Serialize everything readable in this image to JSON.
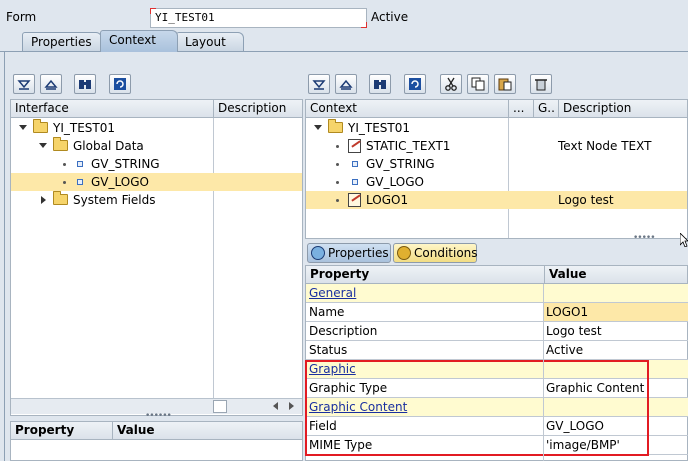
{
  "form": {
    "label": "Form",
    "name": "YI_TEST01",
    "status": "Active"
  },
  "tabs": [
    {
      "label": "Properties",
      "active": false
    },
    {
      "label": "Context",
      "active": true
    },
    {
      "label": "Layout",
      "active": false
    }
  ],
  "interface_panel": {
    "headers": {
      "name": "Interface",
      "description": "Description"
    },
    "nodes": [
      {
        "label": "YI_TEST01",
        "type": "folder",
        "expanded": true
      },
      {
        "label": "Global Data",
        "type": "folder",
        "expanded": true
      },
      {
        "label": "GV_STRING",
        "type": "leaf"
      },
      {
        "label": "GV_LOGO",
        "type": "leaf",
        "selected": true
      },
      {
        "label": "System Fields",
        "type": "folder",
        "expanded": false
      }
    ]
  },
  "interface_props_panel": {
    "headers": {
      "property": "Property",
      "value": "Value"
    }
  },
  "context_panel": {
    "headers": {
      "name": "Context",
      "col2": "...",
      "col3": "G..",
      "description": "Description"
    },
    "nodes": [
      {
        "label": "YI_TEST01",
        "type": "folder",
        "description": ""
      },
      {
        "label": "STATIC_TEXT1",
        "type": "text",
        "description": "Text Node TEXT"
      },
      {
        "label": "GV_STRING",
        "type": "leaf",
        "description": ""
      },
      {
        "label": "GV_LOGO",
        "type": "leaf",
        "description": ""
      },
      {
        "label": "LOGO1",
        "type": "graphic",
        "description": "Logo test",
        "selected": true
      }
    ]
  },
  "bottom_tabs": [
    {
      "label": "Properties",
      "icon": "properties-icon",
      "active": true
    },
    {
      "label": "Conditions",
      "icon": "conditions-icon",
      "active": false
    }
  ],
  "property_grid": {
    "headers": {
      "property": "Property",
      "value": "Value"
    },
    "rows": [
      {
        "name": "General",
        "value": "",
        "group": true
      },
      {
        "name": "Name",
        "value": "LOGO1",
        "highlight": true
      },
      {
        "name": "Description",
        "value": "Logo test"
      },
      {
        "name": "Status",
        "value": "Active"
      },
      {
        "name": "Graphic",
        "value": "",
        "group": true
      },
      {
        "name": "Graphic Type",
        "value": "Graphic Content"
      },
      {
        "name": "Graphic Content",
        "value": "",
        "group": true
      },
      {
        "name": "Field",
        "value": "GV_LOGO"
      },
      {
        "name": "MIME Type",
        "value": "'image/BMP'"
      }
    ]
  },
  "colors": {
    "highlight_box": "#e21b23",
    "selection": "#fde8a8",
    "group_row": "#fffbd0"
  }
}
